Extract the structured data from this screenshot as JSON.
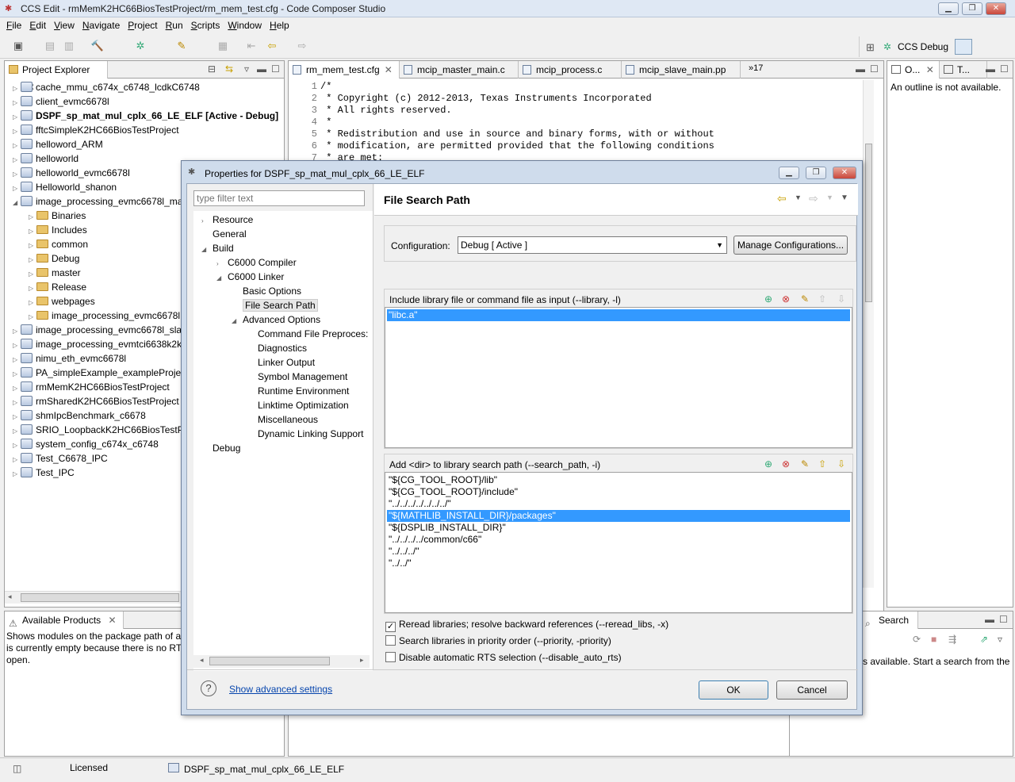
{
  "window": {
    "title": "CCS Edit - rmMemK2HC66BiosTestProject/rm_mem_test.cfg - Code Composer Studio"
  },
  "menu": [
    "File",
    "Edit",
    "View",
    "Navigate",
    "Project",
    "Run",
    "Scripts",
    "Window",
    "Help"
  ],
  "perspective": {
    "label": "CCS Debug"
  },
  "project_explorer": {
    "tab": "Project Explorer",
    "items": [
      {
        "label": "cache_mmu_c674x_c6748_lcdkC6748",
        "level": 0
      },
      {
        "label": "client_evmc6678l",
        "level": 0
      },
      {
        "label": "DSPF_sp_mat_mul_cplx_66_LE_ELF  [Active - Debug]",
        "level": 0
      },
      {
        "label": "fftcSimpleK2HC66BiosTestProject",
        "level": 0
      },
      {
        "label": "helloword_ARM",
        "level": 0
      },
      {
        "label": "helloworld",
        "level": 0
      },
      {
        "label": "helloworld_evmc6678l",
        "level": 0
      },
      {
        "label": "Helloworld_shanon",
        "level": 0
      },
      {
        "label": "image_processing_evmc6678l_ma",
        "level": 0
      },
      {
        "label": "Binaries",
        "level": 1
      },
      {
        "label": "Includes",
        "level": 1
      },
      {
        "label": "common",
        "level": 1
      },
      {
        "label": "Debug",
        "level": 1
      },
      {
        "label": "master",
        "level": 1
      },
      {
        "label": "Release",
        "level": 1
      },
      {
        "label": "webpages",
        "level": 1
      },
      {
        "label": "image_processing_evmc6678l",
        "level": 1
      },
      {
        "label": "image_processing_evmc6678l_slav",
        "level": 0
      },
      {
        "label": "image_processing_evmtci6638k2k",
        "level": 0
      },
      {
        "label": "nimu_eth_evmc6678l",
        "level": 0
      },
      {
        "label": "PA_simpleExample_exampleProjec",
        "level": 0
      },
      {
        "label": "rmMemK2HC66BiosTestProject",
        "level": 0
      },
      {
        "label": "rmSharedK2HC66BiosTestProject",
        "level": 0
      },
      {
        "label": "shmIpcBenchmark_c6678",
        "level": 0
      },
      {
        "label": "SRIO_LoopbackK2HC66BiosTestPr",
        "level": 0
      },
      {
        "label": "system_config_c674x_c6748",
        "level": 0
      },
      {
        "label": "Test_C6678_IPC",
        "level": 0
      },
      {
        "label": "Test_IPC",
        "level": 0
      }
    ]
  },
  "available_products": {
    "tab": "Available Products",
    "text1": "Shows modules on the package path of a",
    "text2": "is currently empty because there is no RTS",
    "text3": "open."
  },
  "editor": {
    "tabs": [
      "rm_mem_test.cfg",
      "mcip_master_main.c",
      "mcip_process.c",
      "mcip_slave_main.pp"
    ],
    "overflow": "»17",
    "lines": [
      {
        "n": "1",
        "t": "/*"
      },
      {
        "n": "2",
        "t": " * Copyright (c) 2012-2013, Texas Instruments Incorporated"
      },
      {
        "n": "3",
        "t": " * All rights reserved."
      },
      {
        "n": "4",
        "t": " *"
      },
      {
        "n": "5",
        "t": " * Redistribution and use in source and binary forms, with or without"
      },
      {
        "n": "6",
        "t": " * modification, are permitted provided that the following conditions"
      },
      {
        "n": "7",
        "t": " * are met:"
      }
    ]
  },
  "outline": {
    "tab1": "O...",
    "tab2": "T...",
    "msg": "An outline is not available."
  },
  "search": {
    "tab": "Search",
    "msg": "s available. Start a search from the"
  },
  "status": {
    "licensed": "Licensed",
    "project": "DSPF_sp_mat_mul_cplx_66_LE_ELF"
  },
  "dialog": {
    "title": "Properties for DSPF_sp_mat_mul_cplx_66_LE_ELF",
    "filter_placeholder": "type filter text",
    "tree": [
      {
        "label": "Resource",
        "level": 0,
        "twisty": "›"
      },
      {
        "label": "General",
        "level": 0,
        "twisty": ""
      },
      {
        "label": "Build",
        "level": 0,
        "twisty": "◢"
      },
      {
        "label": "C6000 Compiler",
        "level": 1,
        "twisty": "›"
      },
      {
        "label": "C6000 Linker",
        "level": 1,
        "twisty": "◢"
      },
      {
        "label": "Basic Options",
        "level": 2,
        "twisty": ""
      },
      {
        "label": "File Search Path",
        "level": 2,
        "twisty": "",
        "selected": true
      },
      {
        "label": "Advanced Options",
        "level": 2,
        "twisty": "◢"
      },
      {
        "label": "Command File Preproces:",
        "level": 3,
        "twisty": ""
      },
      {
        "label": "Diagnostics",
        "level": 3,
        "twisty": ""
      },
      {
        "label": "Linker Output",
        "level": 3,
        "twisty": ""
      },
      {
        "label": "Symbol Management",
        "level": 3,
        "twisty": ""
      },
      {
        "label": "Runtime Environment",
        "level": 3,
        "twisty": ""
      },
      {
        "label": "Linktime Optimization",
        "level": 3,
        "twisty": ""
      },
      {
        "label": "Miscellaneous",
        "level": 3,
        "twisty": ""
      },
      {
        "label": "Dynamic Linking Support",
        "level": 3,
        "twisty": ""
      },
      {
        "label": "Debug",
        "level": 0,
        "twisty": ""
      }
    ],
    "page_title": "File Search Path",
    "config_label": "Configuration:",
    "config_value": "Debug  [ Active ]",
    "manage_btn": "Manage Configurations...",
    "lib_group_label": "Include library file or command file as input (--library, -l)",
    "lib_items": [
      "\"libc.a\""
    ],
    "path_group_label": "Add <dir> to library search path (--search_path, -i)",
    "path_items": [
      "\"${CG_TOOL_ROOT}/lib\"",
      "\"${CG_TOOL_ROOT}/include\"",
      "\"../../../../../../../\"",
      "\"${MATHLIB_INSTALL_DIR}/packages\"",
      "\"${DSPLIB_INSTALL_DIR}\"",
      "\"../../../../common/c66\"",
      "\"../../../\"",
      "\"../../\""
    ],
    "path_selected_index": 3,
    "checks": [
      {
        "label": "Reread libraries; resolve backward references (--reread_libs, -x)",
        "checked": true
      },
      {
        "label": "Search libraries in priority order (--priority, -priority)",
        "checked": false
      },
      {
        "label": "Disable automatic RTS selection (--disable_auto_rts)",
        "checked": false
      }
    ],
    "advanced_link": "Show advanced settings",
    "ok": "OK",
    "cancel": "Cancel"
  }
}
